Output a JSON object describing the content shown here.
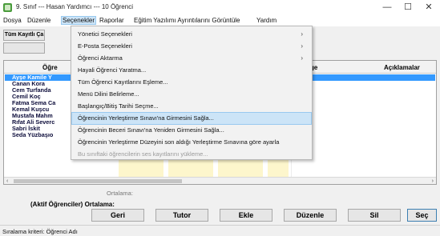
{
  "window": {
    "title": "9. Sınıf --- Hasan Yardımcı --- 10 Öğrenci",
    "minimize": "—",
    "maximize": "☐",
    "close": "✕"
  },
  "menubar": {
    "items": [
      "Dosya",
      "Düzenle",
      "Seçenekler",
      "Raporlar",
      "Eğitim Yazılımı Ayrıntılarını Görüntüle",
      "Yardım"
    ]
  },
  "toolbar": {
    "all_records_label": "Tüm Kayıtlı Ça"
  },
  "dropdown": {
    "items": [
      {
        "label": "Yönetici Seçenekleri",
        "submenu": true
      },
      {
        "label": "E-Posta Seçenekleri",
        "submenu": true
      },
      {
        "label": "Öğrenci Aktarma",
        "submenu": true
      },
      {
        "label": "Hayali Öğrenci Yaratma..."
      },
      {
        "label": "Tüm Öğrenci Kayıtlarını Eşleme..."
      },
      {
        "label": "Menü Dilini Belirleme..."
      },
      {
        "label": "Başlangıç/Bitiş Tarihi Seçme..."
      },
      {
        "label": "Öğrencinin Yerleştirme Sınavı'na Girmesini Sağla..."
      },
      {
        "label": "Öğrencinin Beceri Sınavı'na Yeniden Girmesini Sağla..."
      },
      {
        "label": "Öğrencinin Yerleştirme Düzeyini son aldığı Yerleştirme Sınavına göre ayarla"
      },
      {
        "label": "Bu sınıftaki öğrencilerin ses kayıtlarını yükleme..."
      }
    ],
    "submenu_arrow": "›"
  },
  "grid": {
    "headers": {
      "name": "Öğre",
      "change": "Change",
      "notes": "Açıklamalar"
    },
    "students": [
      "Ayşe Kamile Y",
      "Canan Kora",
      "Cem Turfanda",
      "Cemil Koç",
      "Fatma Sema Ca",
      "Kemal Kuşcu",
      "Mustafa Mahm",
      "Rıfat Ali Severc",
      "Sabri İskit",
      "Seda Yüzbaşıo"
    ],
    "scroll_left": "‹",
    "scroll_right": "›"
  },
  "summary": {
    "average_label": "Ortalama:",
    "active_average_label": "(Aktif Öğrenciler) Ortalama:"
  },
  "buttons": {
    "back": "Geri",
    "hold": "Tutor",
    "add": "Ekle",
    "edit": "Düzenle",
    "delete": "Sil",
    "select": "Seç"
  },
  "status": {
    "text": "Sıralama kriteri:  Öğrenci Adı"
  }
}
